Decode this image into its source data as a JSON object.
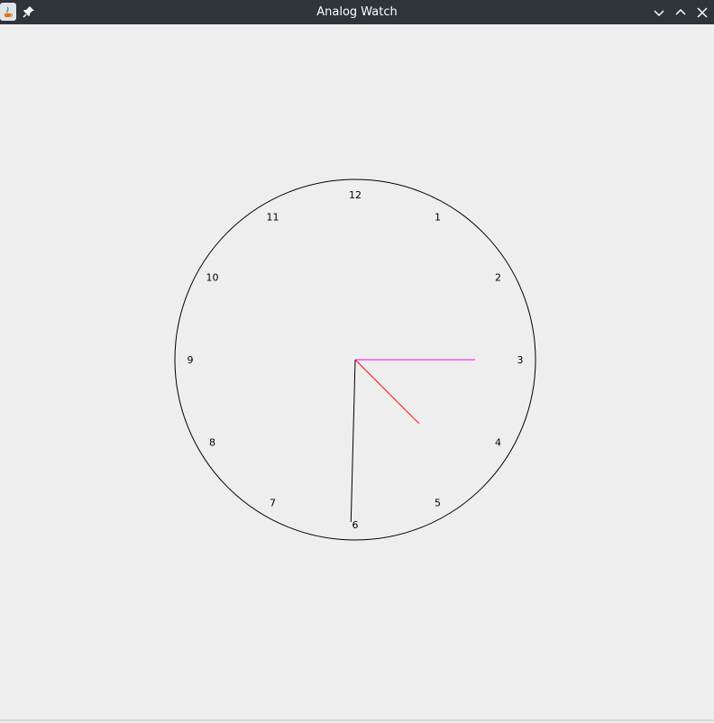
{
  "window": {
    "title": "Analog Watch",
    "icons": {
      "app": "java-app-icon",
      "pin": "pin-icon",
      "minimize": "chevron-down-icon",
      "maximize": "chevron-up-icon",
      "close": "close-icon"
    }
  },
  "clock": {
    "numerals": [
      "12",
      "1",
      "2",
      "3",
      "4",
      "5",
      "6",
      "7",
      "8",
      "9",
      "10",
      "11"
    ],
    "colors": {
      "face": "#000000",
      "hour_hand": "#ff0000",
      "minute_hand": "#000000",
      "second_hand": "#ff00ff"
    },
    "time": {
      "hour": 4,
      "minute": 30,
      "second": 15
    }
  }
}
